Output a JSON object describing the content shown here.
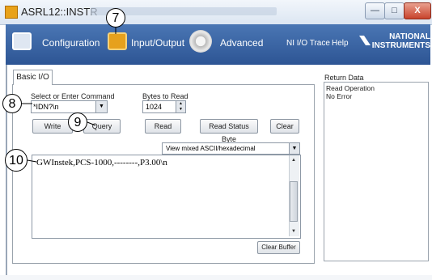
{
  "window": {
    "title": "ASRL12::INSTR",
    "min_label": "—",
    "max_label": "□",
    "close_label": "X"
  },
  "toolbar": {
    "configuration": "Configuration",
    "input_output": "Input/Output",
    "advanced": "Advanced",
    "ni_io_trace": "NI I/O Trace",
    "help": "Help",
    "logo_line1": "NATIONAL",
    "logo_line2": "INSTRUMENTS"
  },
  "basic_io": {
    "tab_label": "Basic I/O",
    "select_label": "Select or Enter Command",
    "command_value": "*IDN?\\n",
    "bytes_label": "Bytes to Read",
    "bytes_value": "1024",
    "buttons": {
      "write": "Write",
      "query": "Query",
      "read": "Read",
      "read_status_byte": "Read Status Byte",
      "clear": "Clear",
      "clear_buffer": "Clear Buffer"
    },
    "view_mode": "View mixed ASCII/hexadecimal",
    "output_text": "GWInstek,PCS-1000,--------,P3.00\\n"
  },
  "return_data": {
    "label": "Return Data",
    "lines": [
      "Read Operation",
      "No Error"
    ]
  },
  "callouts": [
    "7",
    "8",
    "9",
    "10"
  ],
  "icons": {
    "config": "configuration-icon",
    "io": "input-output-icon",
    "advanced": "gear-icon",
    "dropdown": "chevron-down-icon"
  },
  "colors": {
    "toolbar": "#2d5594",
    "io_accent": "#e6a11d"
  }
}
